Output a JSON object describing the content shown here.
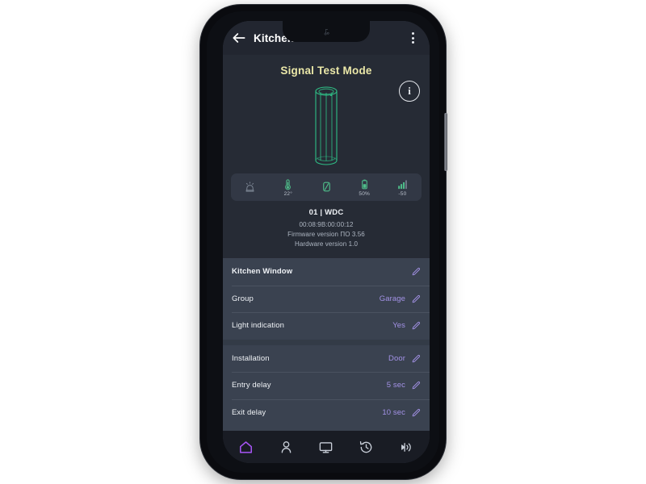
{
  "appbar": {
    "title": "Kitchen Window",
    "back_icon": "back-arrow-icon",
    "menu_icon": "kebab-menu-icon"
  },
  "hero": {
    "mode_title": "Signal Test Mode",
    "info_label": "i",
    "device_icon": "door-contact-magnet-3d-icon"
  },
  "status_strip": [
    {
      "icon": "siren-icon",
      "value": "",
      "color": "#7d8694"
    },
    {
      "icon": "thermometer-icon",
      "value": "22°",
      "color": "#4fbf8b"
    },
    {
      "icon": "connection-icon",
      "value": "",
      "color": "#4fbf8b"
    },
    {
      "icon": "battery-icon",
      "value": "50%",
      "color": "#4fbf8b"
    },
    {
      "icon": "signal-bars-icon",
      "value": "-50",
      "color": "#4fbf8b"
    }
  ],
  "device_meta": {
    "title": "01 | WDC",
    "mac": "00:08:9B:00:00:12",
    "firmware": "Firmware version ПО 3.56",
    "hardware": "Hardware version 1.0"
  },
  "settings": {
    "group_one": [
      {
        "label": "Kitchen Window",
        "value": "",
        "edit_icon": "pencil-icon"
      },
      {
        "label": "Group",
        "value": "Garage",
        "edit_icon": "pencil-icon"
      },
      {
        "label": "Light indication",
        "value": "Yes",
        "edit_icon": "pencil-icon"
      }
    ],
    "group_two": [
      {
        "label": "Installation",
        "value": "Door",
        "edit_icon": "pencil-icon"
      },
      {
        "label": "Entry delay",
        "value": "5 sec",
        "edit_icon": "pencil-icon"
      },
      {
        "label": "Exit delay",
        "value": "10 sec",
        "edit_icon": "pencil-icon"
      }
    ]
  },
  "bottom_nav": [
    {
      "icon": "home-icon",
      "active": true
    },
    {
      "icon": "user-icon",
      "active": false
    },
    {
      "icon": "monitor-icon",
      "active": false
    },
    {
      "icon": "history-icon",
      "active": false
    },
    {
      "icon": "broadcast-icon",
      "active": false
    }
  ],
  "colors": {
    "accent_purple": "#a855f7",
    "value_purple": "#a392e6",
    "green": "#4fbf8b",
    "mode_yellow": "#eae7a8",
    "screen_bg": "#2c323d",
    "list_bg": "#3a4250"
  }
}
